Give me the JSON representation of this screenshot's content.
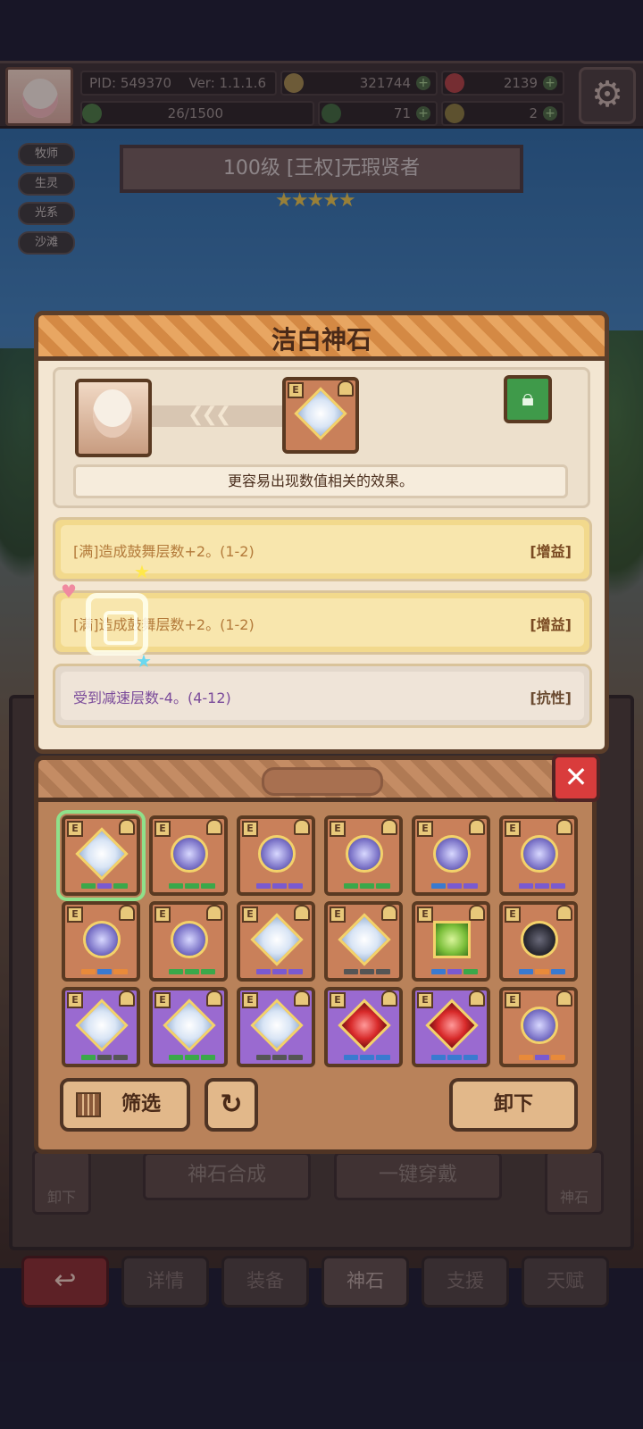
{
  "header": {
    "pid": "PID: 549370",
    "version": "Ver: 1.1.1.6",
    "gold": "321744",
    "gems": "2139",
    "energy": "26/1500",
    "clover": "71",
    "keys": "2",
    "settings_icon": "gear-icon"
  },
  "hero": {
    "tags": [
      "牧师",
      "生灵",
      "光系",
      "沙滩"
    ],
    "title": "100级  [王权]无瑕贤者",
    "stars": "★★★★★"
  },
  "gem_detail": {
    "title": "洁白神石",
    "description": "更容易出现数值相关的效果。",
    "effects": [
      {
        "text": "[满]造成鼓舞层数+2。(1-2)",
        "kind": "[增益]"
      },
      {
        "text": "[满]造成鼓舞层数+2。(1-2)",
        "kind": "[增益]"
      },
      {
        "text": "受到减速层数-4。(4-12)",
        "kind": "[抗性]"
      }
    ]
  },
  "inventory": {
    "slot_badge": "E",
    "filter_label": "筛选",
    "unequip_label": "卸下",
    "slots": [
      {
        "bg": "orange",
        "gem": "white",
        "bars": [
          "#3aa84a",
          "#7a5ad0",
          "#3aa84a"
        ],
        "selected": true
      },
      {
        "bg": "orange",
        "gem": "violet",
        "bars": [
          "#3aa84a",
          "#3aa84a",
          "#3aa84a"
        ]
      },
      {
        "bg": "orange",
        "gem": "violet",
        "bars": [
          "#7a5ad0",
          "#7a5ad0",
          "#7a5ad0"
        ]
      },
      {
        "bg": "orange",
        "gem": "violet",
        "bars": [
          "#3aa84a",
          "#3aa84a",
          "#3aa84a"
        ]
      },
      {
        "bg": "orange",
        "gem": "violet",
        "bars": [
          "#3a7ad0",
          "#7a5ad0",
          "#7a5ad0"
        ]
      },
      {
        "bg": "orange",
        "gem": "violet",
        "bars": [
          "#7a5ad0",
          "#7a5ad0",
          "#7a5ad0"
        ]
      },
      {
        "bg": "orange",
        "gem": "violet",
        "bars": [
          "#e88a3a",
          "#3a7ad0",
          "#e88a3a"
        ]
      },
      {
        "bg": "orange",
        "gem": "violet",
        "bars": [
          "#3aa84a",
          "#3aa84a",
          "#3aa84a"
        ]
      },
      {
        "bg": "orange",
        "gem": "white",
        "bars": [
          "#7a5ad0",
          "#7a5ad0",
          "#7a5ad0"
        ]
      },
      {
        "bg": "orange",
        "gem": "white",
        "bars": [
          "#555555",
          "#555555",
          "#555555"
        ]
      },
      {
        "bg": "orange",
        "gem": "green",
        "bars": [
          "#3a7ad0",
          "#7a5ad0",
          "#3aa84a"
        ]
      },
      {
        "bg": "orange",
        "gem": "black",
        "bars": [
          "#3a7ad0",
          "#e88a3a",
          "#3a7ad0"
        ]
      },
      {
        "bg": "purple",
        "gem": "white",
        "bars": [
          "#3aa84a",
          "#555555",
          "#555555"
        ]
      },
      {
        "bg": "purple",
        "gem": "white",
        "bars": [
          "#3aa84a",
          "#3aa84a",
          "#3aa84a"
        ]
      },
      {
        "bg": "purple",
        "gem": "white",
        "bars": [
          "#555555",
          "#555555",
          "#555555"
        ]
      },
      {
        "bg": "purple",
        "gem": "red",
        "bars": [
          "#3a7ad0",
          "#3a7ad0",
          "#3a7ad0"
        ]
      },
      {
        "bg": "purple",
        "gem": "red",
        "bars": [
          "#3a7ad0",
          "#3a7ad0",
          "#3a7ad0"
        ]
      },
      {
        "bg": "orange",
        "gem": "violet",
        "bars": [
          "#e88a3a",
          "#7a5ad0",
          "#e88a3a"
        ]
      }
    ]
  },
  "background": {
    "unequip": "卸下",
    "synthesis": "神石合成",
    "equip_all": "一键穿戴",
    "gem": "神石"
  },
  "tabs": [
    "详情",
    "装备",
    "神石",
    "支援",
    "天赋"
  ]
}
